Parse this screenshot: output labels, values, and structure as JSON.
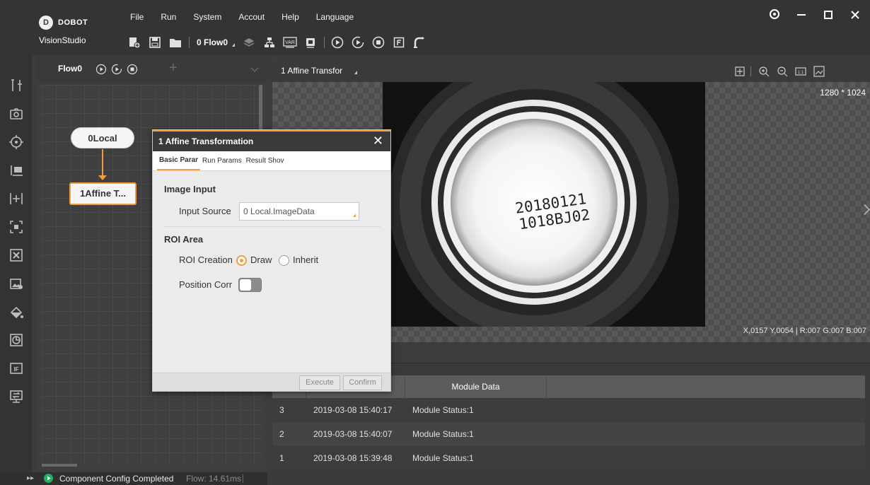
{
  "app": {
    "brand": "DOBOT",
    "name": "VisionStudio"
  },
  "menu": [
    "File",
    "Run",
    "System",
    "Accout",
    "Help",
    "Language"
  ],
  "toolbar": {
    "flow_selector": "0 Flow0"
  },
  "flow_panel": {
    "flow_name": "Flow0",
    "nodes": {
      "source": "0Local",
      "transform": "1Affine T..."
    }
  },
  "status": {
    "message": "Component Config Completed",
    "flow_time": "Flow: 14.61ms"
  },
  "view": {
    "title": "1 Affine Transfor",
    "image_size": "1280 * 1024",
    "pixel_info": "X,0157 Y,0054 | R:007 G:007 B:007",
    "printed_text_line1": "20180121",
    "printed_text_line2": "1018BJ02"
  },
  "results": {
    "header_data": "Module Data",
    "rows": [
      {
        "id": "3",
        "time": "2019-03-08 15:40:17",
        "data": "Module Status:1"
      },
      {
        "id": "2",
        "time": "2019-03-08 15:40:07",
        "data": "Module Status:1"
      },
      {
        "id": "1",
        "time": "2019-03-08 15:39:48",
        "data": "Module Status:1"
      }
    ]
  },
  "dialog": {
    "title": "1 Affine Transformation",
    "tabs": [
      "Basic Parar",
      "Run Params",
      "Result Shov"
    ],
    "image_input": {
      "section": "Image Input",
      "label": "Input Source",
      "value": "0 Local.ImageData"
    },
    "roi": {
      "section": "ROI Area",
      "creation_label": "ROI Creation",
      "option_draw": "Draw",
      "option_inherit": "Inherit",
      "position_label": "Position Corr"
    },
    "buttons": {
      "execute": "Execute",
      "confirm": "Confirm"
    }
  },
  "colors": {
    "accent": "#f39c3a",
    "status_ok": "#27ae60"
  }
}
